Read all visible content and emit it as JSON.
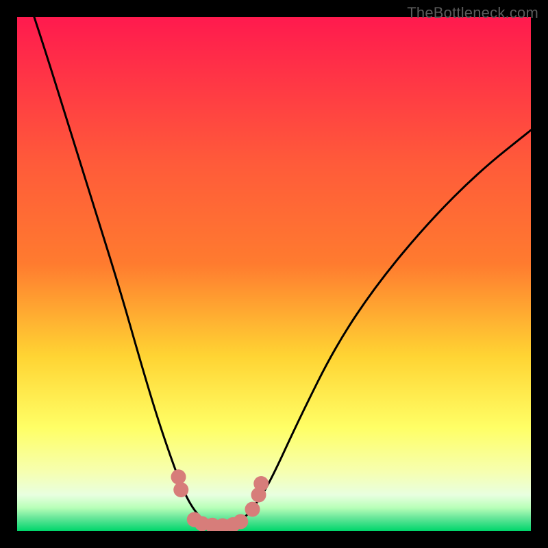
{
  "watermark": "TheBottleneck.com",
  "colors": {
    "background": "#000000",
    "grad_top": "#ff1a4e",
    "grad_mid1": "#ff7b2f",
    "grad_mid2": "#ffd433",
    "grad_mid3": "#ffff66",
    "grad_mid4": "#f6ffb0",
    "grad_bottom1": "#b8ffb8",
    "grad_bottom2": "#00d66b",
    "curve": "#000000",
    "dot_fill": "#d77d7a",
    "dot_stroke": "#b25a57"
  },
  "chart_data": {
    "type": "line",
    "title": "",
    "xlabel": "",
    "ylabel": "",
    "xlim": [
      0,
      100
    ],
    "ylim": [
      0,
      100
    ],
    "series": [
      {
        "name": "bottleneck-curve",
        "x": [
          0,
          5,
          10,
          15,
          20,
          24,
          27,
          29.5,
          31.5,
          33,
          34.5,
          36,
          38,
          42,
          44,
          46,
          49,
          55,
          62,
          70,
          80,
          90,
          100
        ],
        "y": [
          110,
          95,
          79,
          63,
          47,
          33,
          23,
          15.5,
          10,
          6.5,
          4,
          2.3,
          1.2,
          1.2,
          2.3,
          4.5,
          9,
          22,
          36,
          48,
          60,
          70,
          78
        ]
      }
    ],
    "markers": [
      {
        "x": 31.4,
        "y": 10.5
      },
      {
        "x": 31.9,
        "y": 8.0
      },
      {
        "x": 34.5,
        "y": 2.2
      },
      {
        "x": 36.0,
        "y": 1.4
      },
      {
        "x": 38.0,
        "y": 1.1
      },
      {
        "x": 40.0,
        "y": 1.0
      },
      {
        "x": 42.0,
        "y": 1.2
      },
      {
        "x": 43.5,
        "y": 1.8
      },
      {
        "x": 45.8,
        "y": 4.2
      },
      {
        "x": 47.0,
        "y": 7.0
      },
      {
        "x": 47.5,
        "y": 9.2
      }
    ]
  }
}
